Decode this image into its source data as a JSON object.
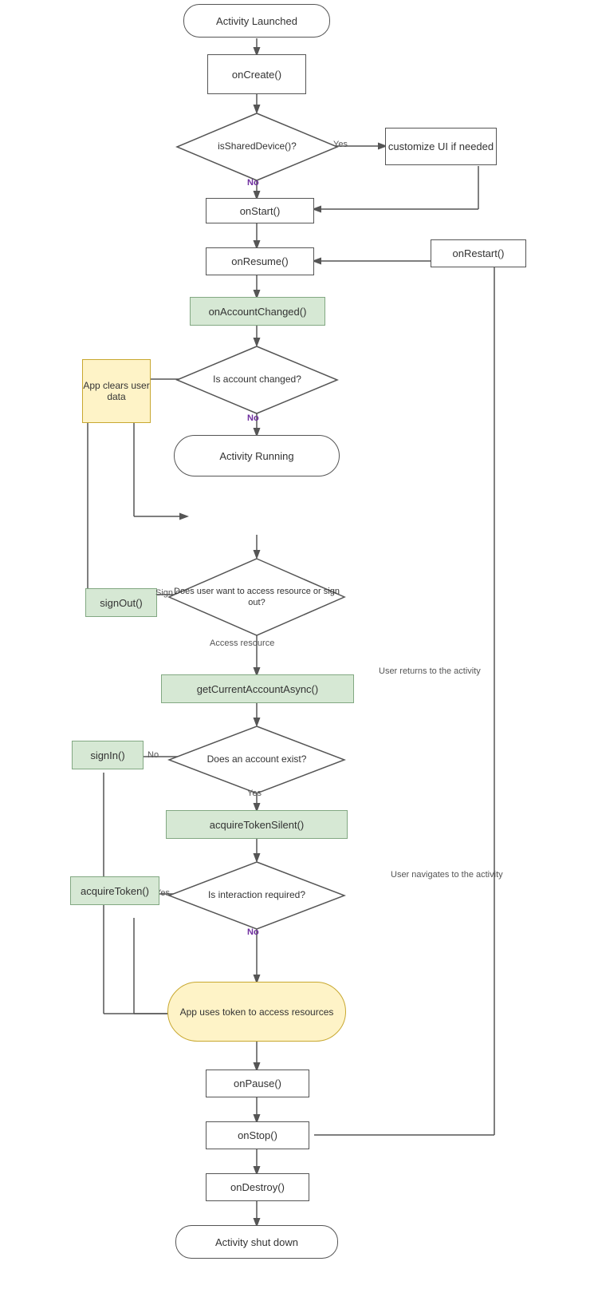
{
  "nodes": {
    "activity_launched": {
      "label": "Activity Launched"
    },
    "on_create": {
      "label": "onCreate()"
    },
    "is_shared_device": {
      "label": "isSharedDevice()?"
    },
    "customize_ui": {
      "label": "customize UI if needed"
    },
    "on_start": {
      "label": "onStart()"
    },
    "on_resume": {
      "label": "onResume()"
    },
    "on_restart": {
      "label": "onRestart()"
    },
    "on_account_changed": {
      "label": "onAccountChanged()"
    },
    "is_account_changed": {
      "label": "Is account changed?"
    },
    "app_clears_user_data": {
      "label": "App clears user data"
    },
    "activity_running": {
      "label": "Activity Running"
    },
    "sign_out": {
      "label": "signOut()"
    },
    "does_user_want": {
      "label": "Does user want to access resource or sign out?"
    },
    "get_current_account": {
      "label": "getCurrentAccountAsync()"
    },
    "does_account_exist": {
      "label": "Does an account exist?"
    },
    "sign_in": {
      "label": "signIn()"
    },
    "acquire_token_silent": {
      "label": "acquireTokenSilent()"
    },
    "is_interaction_required": {
      "label": "Is interaction required?"
    },
    "acquire_token": {
      "label": "acquireToken()"
    },
    "app_uses_token": {
      "label": "App uses token to access resources"
    },
    "on_pause": {
      "label": "onPause()"
    },
    "on_stop": {
      "label": "onStop()"
    },
    "on_destroy": {
      "label": "onDestroy()"
    },
    "activity_shutdown": {
      "label": "Activity shut down"
    }
  },
  "labels": {
    "yes": "Yes",
    "no": "No",
    "sign_out": "Sign out",
    "access_resource": "Access resource",
    "user_returns": "User returns to the activity",
    "user_navigates": "User navigates to the activity"
  }
}
